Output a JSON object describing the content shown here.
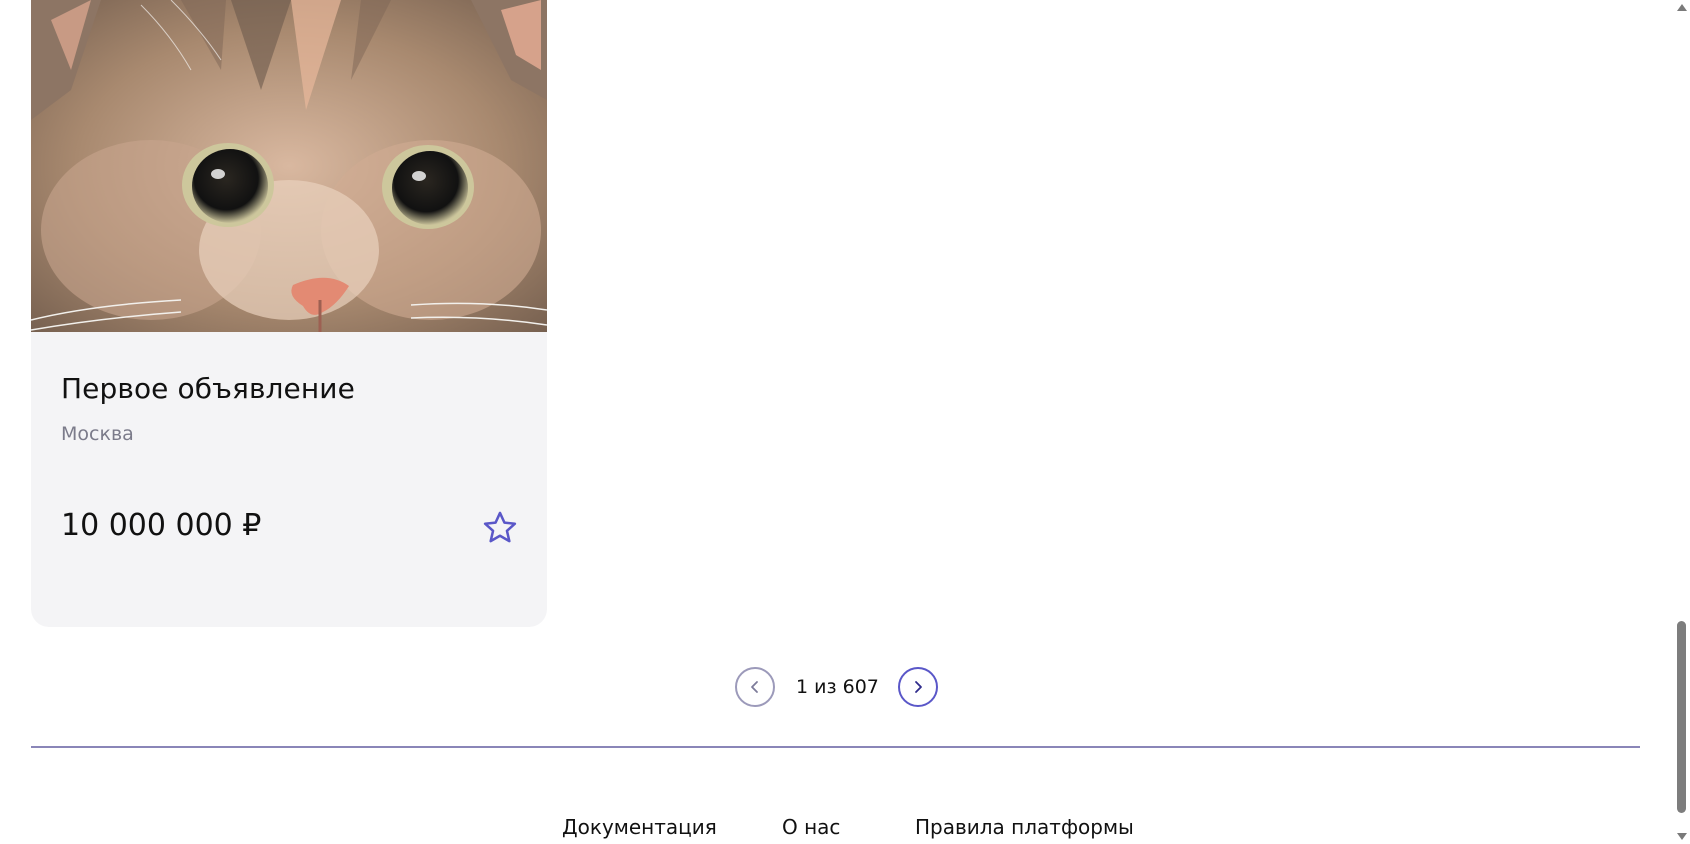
{
  "listing": {
    "photo_alt": "cat-photo",
    "title": "Первое объявление",
    "city": "Москва",
    "price": "10 000 000 ₽",
    "favorite_icon": "star-outline-icon"
  },
  "pagination": {
    "text": "1 из 607",
    "prev_icon": "chevron-left-icon",
    "next_icon": "chevron-right-icon"
  },
  "footer": {
    "links": [
      "Документация",
      "О нас",
      "Правила платформы"
    ]
  },
  "colors": {
    "accent": "#5a57c8",
    "card_background": "#f4f4f6",
    "divider": "#8a86b8",
    "muted_text": "#7b7b8a"
  }
}
